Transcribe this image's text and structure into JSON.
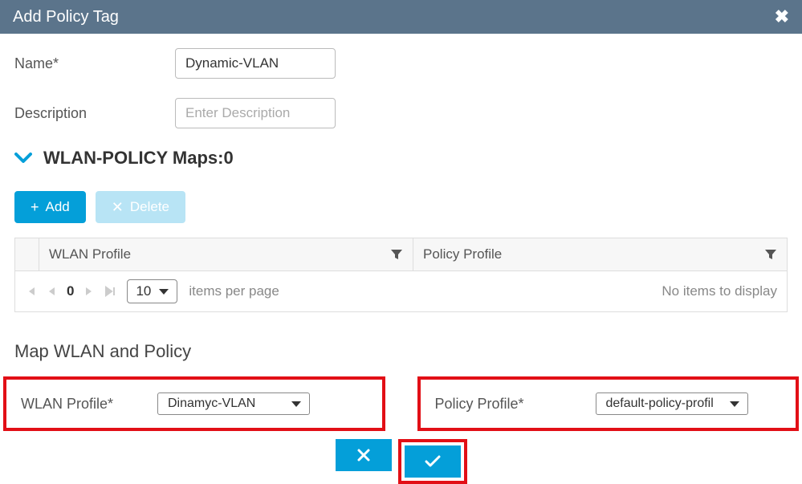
{
  "header": {
    "title": "Add Policy Tag"
  },
  "form": {
    "name_label": "Name*",
    "name_value": "Dynamic-VLAN",
    "description_label": "Description",
    "description_placeholder": "Enter Description"
  },
  "section": {
    "title_prefix": "WLAN-POLICY Maps: ",
    "count": "0"
  },
  "buttons": {
    "add": "Add",
    "delete": "Delete"
  },
  "grid": {
    "columns": {
      "wlan": "WLAN Profile",
      "policy": "Policy Profile"
    },
    "page_current": "0",
    "page_size": "10",
    "per_page_text": "items per page",
    "empty_text": "No items to display"
  },
  "map": {
    "heading": "Map WLAN and Policy",
    "wlan_label": "WLAN Profile*",
    "wlan_value": "Dinamyc-VLAN",
    "policy_label": "Policy Profile*",
    "policy_value": "default-policy-profil"
  }
}
